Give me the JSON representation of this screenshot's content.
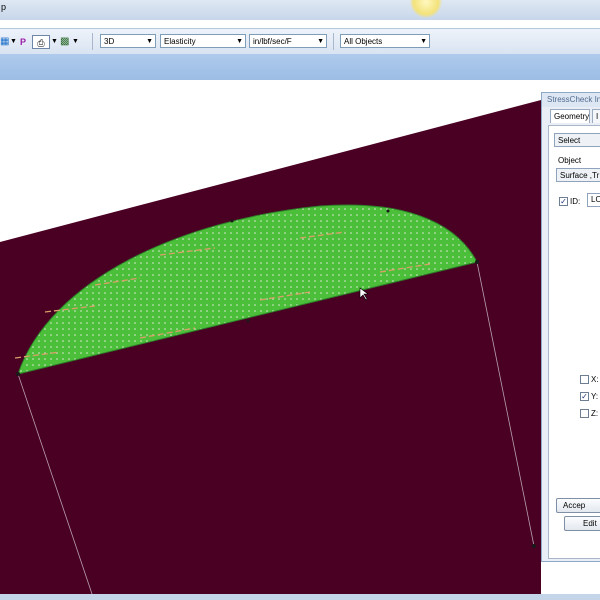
{
  "title_bar": {
    "glyph": "p"
  },
  "toolbar": {
    "view_mode": "3D",
    "analysis_type": "Elasticity",
    "units": "in/lbf/sec/F",
    "filter": "All Objects",
    "letter_p": "P"
  },
  "panel": {
    "title": "StressCheck Inp",
    "tabs": [
      "Geometry",
      "I"
    ],
    "method": "Select",
    "object_label": "Object",
    "object_value": "Surface ,Tr",
    "id_label": "ID:",
    "id_value": "LO",
    "id_checked": true,
    "components": [
      {
        "label": "X:",
        "checked": false
      },
      {
        "label": "Y:",
        "checked": true
      },
      {
        "label": "Z:",
        "checked": false
      }
    ],
    "accept_label": "Accep",
    "edit_label": "Edit"
  },
  "colors": {
    "plane": "#4a0023",
    "surface": "#4cbf3a",
    "accent": "#d9b36a"
  }
}
